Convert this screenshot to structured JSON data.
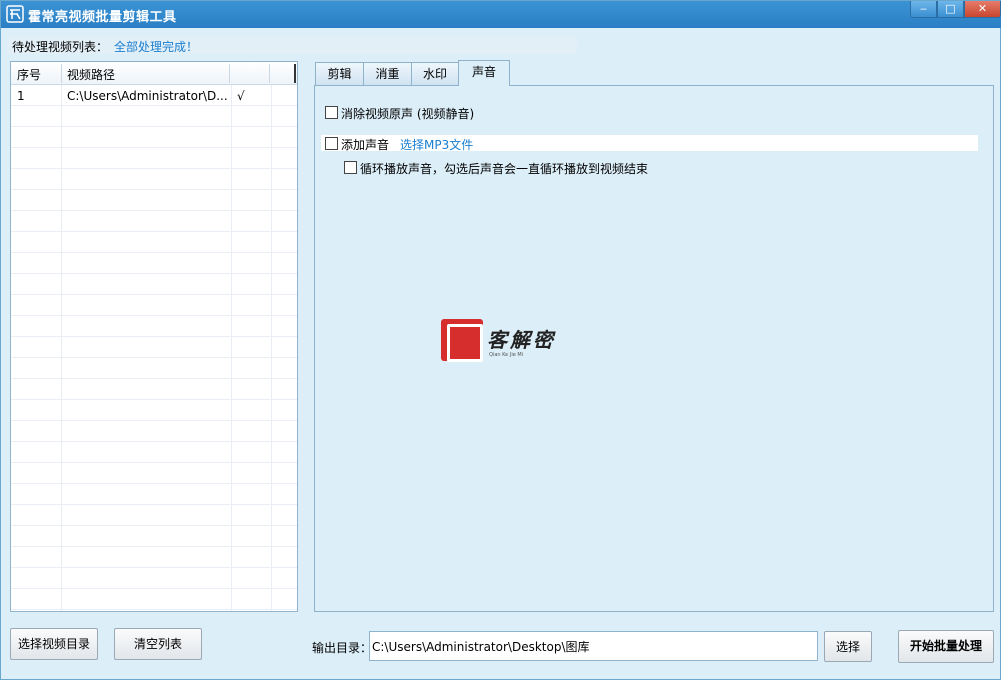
{
  "window": {
    "title": "霍常亮视频批量剪辑工具",
    "minimize_glyph": "‒",
    "maximize_glyph": "□",
    "close_glyph": "✕"
  },
  "pending": {
    "label": "待处理视频列表：",
    "status": "全部处理完成！"
  },
  "table": {
    "columns": [
      "序号",
      "视频路径",
      ""
    ],
    "rows": [
      {
        "index": "1",
        "path": "C:\\Users\\Administrator\\D...",
        "status": "√"
      }
    ]
  },
  "buttons": {
    "select_dir": "选择视频目录",
    "clear_list": "清空列表",
    "select_output": "选择",
    "start_batch": "开始批量处理"
  },
  "tabs": [
    "剪辑",
    "消重",
    "水印",
    "声音"
  ],
  "active_tab": "声音",
  "sound_panel": {
    "remove_original": "消除视频原声 (视频静音)",
    "add_audio": "添加声音",
    "choose_mp3": "选择MP3文件",
    "loop_audio": "循环播放声音，勾选后声音会一直循环播放到视频结束"
  },
  "output": {
    "label": "输出目录：",
    "path": "C:\\Users\\Administrator\\Desktop\\图库"
  },
  "watermark": {
    "text": "客解密",
    "sub": "Qian Ke Jie Mi"
  },
  "colors": {
    "title_bar": "#2a7fc4",
    "background": "#dceef8",
    "link": "#1a7fd0",
    "close": "#c8462f"
  }
}
